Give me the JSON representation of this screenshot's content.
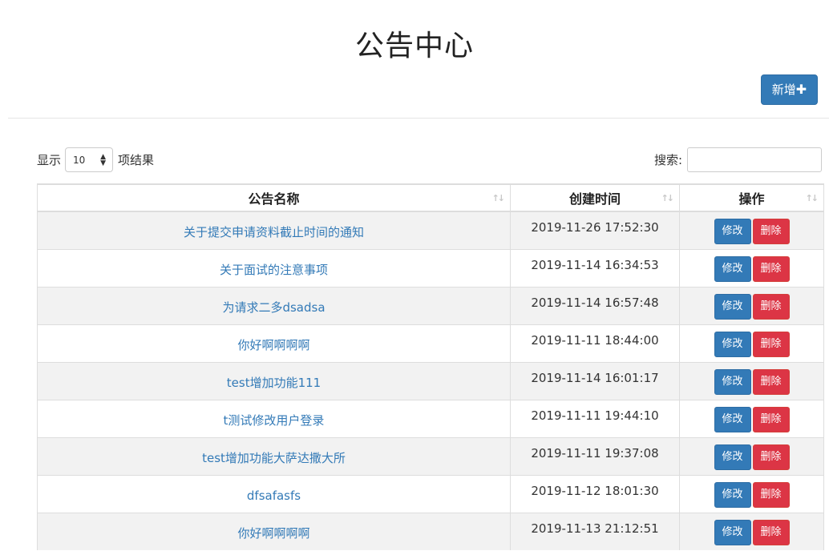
{
  "header": {
    "title": "公告中心",
    "add_label": "新增",
    "add_icon": "plus-icon"
  },
  "controls": {
    "show_prefix": "显示",
    "page_length": "10",
    "show_suffix": "项结果",
    "search_label": "搜索:",
    "search_value": ""
  },
  "table": {
    "columns": [
      "公告名称",
      "创建时间",
      "操作"
    ],
    "edit_label": "修改",
    "delete_label": "删除",
    "rows": [
      {
        "name": "关于提交申请资料截止时间的通知",
        "time": "2019-11-26 17:52:30"
      },
      {
        "name": "关于面试的注意事项",
        "time": "2019-11-14 16:34:53"
      },
      {
        "name": "为请求二多dsadsa",
        "time": "2019-11-14 16:57:48"
      },
      {
        "name": "你好啊啊啊啊",
        "time": "2019-11-11 18:44:00"
      },
      {
        "name": "test增加功能111",
        "time": "2019-11-14 16:01:17"
      },
      {
        "name": "t测试修改用户登录",
        "time": "2019-11-11 19:44:10"
      },
      {
        "name": "test增加功能大萨达撒大所",
        "time": "2019-11-11 19:37:08"
      },
      {
        "name": "dfsafasfs",
        "time": "2019-11-12 18:01:30"
      },
      {
        "name": "你好啊啊啊啊",
        "time": "2019-11-13 21:12:51"
      }
    ]
  },
  "colors": {
    "primary": "#337ab7",
    "danger": "#dc3545",
    "stripe": "#f2f2f2"
  }
}
